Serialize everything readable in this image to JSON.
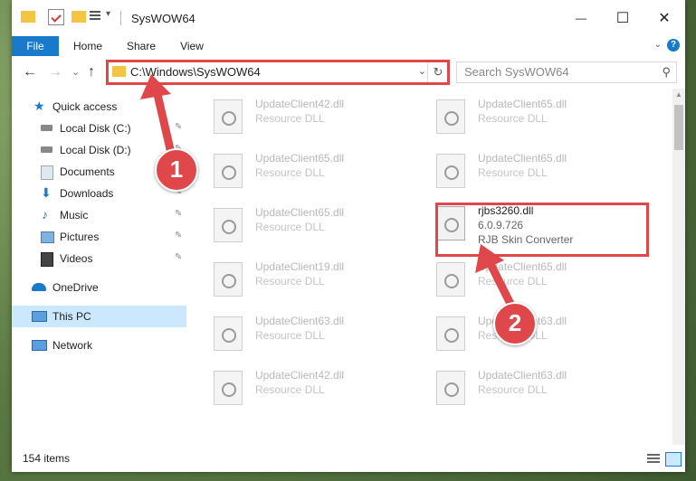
{
  "window": {
    "title": "SysWOW64",
    "minimize_glyph": "—",
    "maximize_glyph": "☐",
    "close_glyph": "✕"
  },
  "ribbon": {
    "tabs": [
      "File",
      "Home",
      "Share",
      "View"
    ],
    "help_glyph": "?",
    "expand_glyph": "⌄"
  },
  "nav": {
    "back_glyph": "←",
    "forward_glyph": "→",
    "recent_glyph": "⌄",
    "up_glyph": "↑",
    "address_path": "C:\\Windows\\SysWOW64",
    "address_dropdown_glyph": "⌄",
    "refresh_glyph": "↻",
    "search_placeholder": "Search SysWOW64",
    "search_glyph": "⚲"
  },
  "sidebar": {
    "items": [
      {
        "label": "Quick access",
        "icon": "star-icon",
        "pinned": false
      },
      {
        "label": "Local Disk (C:)",
        "icon": "drive-icon",
        "pinned": true
      },
      {
        "label": "Local Disk (D:)",
        "icon": "drive-icon",
        "pinned": true
      },
      {
        "label": "Documents",
        "icon": "documents-icon",
        "pinned": true
      },
      {
        "label": "Downloads",
        "icon": "download-icon",
        "pinned": true
      },
      {
        "label": "Music",
        "icon": "music-icon",
        "pinned": true
      },
      {
        "label": "Pictures",
        "icon": "pictures-icon",
        "pinned": true
      },
      {
        "label": "Videos",
        "icon": "videos-icon",
        "pinned": true
      },
      {
        "label": "OneDrive",
        "icon": "cloud-icon",
        "pinned": false
      },
      {
        "label": "This PC",
        "icon": "computer-icon",
        "pinned": false
      },
      {
        "label": "Network",
        "icon": "network-icon",
        "pinned": false
      }
    ],
    "pin_glyph": "📌"
  },
  "files": {
    "left": [
      {
        "name": "UpdateClient42.dll",
        "desc": "Resource DLL"
      },
      {
        "name": "UpdateClient65.dll",
        "desc": "Resource DLL"
      },
      {
        "name": "UpdateClient65.dll",
        "desc": "Resource DLL"
      },
      {
        "name": "UpdateClient19.dll",
        "desc": "Resource DLL"
      },
      {
        "name": "UpdateClient63.dll",
        "desc": "Resource DLL"
      },
      {
        "name": "UpdateClient42.dll",
        "desc": "Resource DLL"
      }
    ],
    "right": [
      {
        "name": "UpdateClient65.dll",
        "desc": "Resource DLL"
      },
      {
        "name": "UpdateClient65.dll",
        "desc": "Resource DLL"
      },
      {
        "name": "rjbs3260.dll",
        "version": "6.0.9.726",
        "desc": "RJB Skin Converter"
      },
      {
        "name": "UpdateClient65.dll",
        "desc": "Resource DLL"
      },
      {
        "name": "UpdateClient63.dll",
        "desc": "Resource DLL"
      },
      {
        "name": "UpdateClient63.dll",
        "desc": "Resource DLL"
      }
    ]
  },
  "status": {
    "item_count": "154 items"
  },
  "annotations": {
    "step1": "1",
    "step2": "2",
    "color": "#e0474a"
  }
}
